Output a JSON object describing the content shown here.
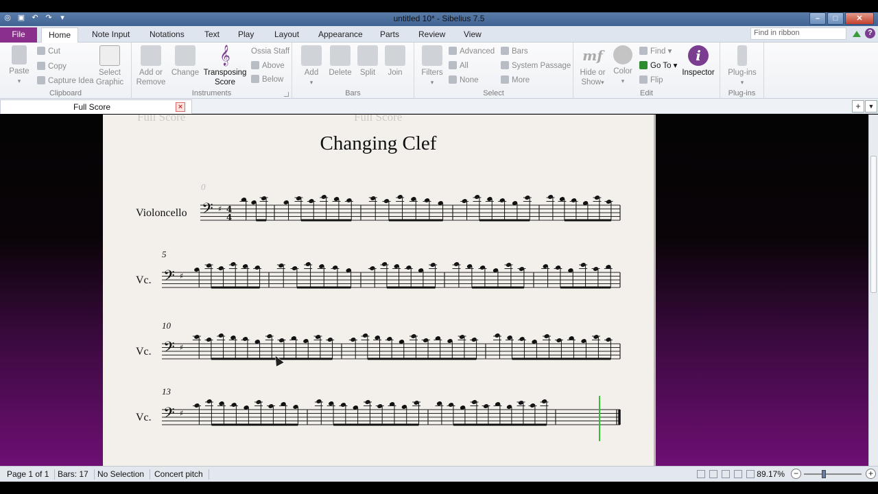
{
  "window": {
    "title": "untitled 10* - Sibelius 7.5"
  },
  "tabs": [
    "Home",
    "Note Input",
    "Notations",
    "Text",
    "Play",
    "Layout",
    "Appearance",
    "Parts",
    "Review",
    "View"
  ],
  "file_tab": "File",
  "search": {
    "placeholder": "Find in ribbon"
  },
  "ribbon": {
    "clipboard": {
      "label": "Clipboard",
      "paste": "Paste",
      "cut": "Cut",
      "copy": "Copy",
      "capture": "Capture Idea",
      "select_graphic_1": "Select",
      "select_graphic_2": "Graphic"
    },
    "instruments": {
      "label": "Instruments",
      "add_1": "Add or",
      "add_2": "Remove",
      "change": "Change",
      "transposing_1": "Transposing",
      "transposing_2": "Score",
      "ossia": "Ossia Staff",
      "above": "Above",
      "below": "Below"
    },
    "bars": {
      "label": "Bars",
      "add": "Add",
      "delete": "Delete",
      "split": "Split",
      "join": "Join"
    },
    "select": {
      "label": "Select",
      "filters": "Filters",
      "advanced": "Advanced",
      "all": "All",
      "none": "None",
      "bars": "Bars",
      "system_passage": "System Passage",
      "more": "More"
    },
    "edit": {
      "label": "Edit",
      "hide_1": "Hide or",
      "hide_2": "Show",
      "color": "Color",
      "find": "Find",
      "goto": "Go To",
      "flip": "Flip",
      "inspector": "Inspector"
    },
    "plugins": {
      "label": "Plug-ins",
      "plugins": "Plug-ins"
    }
  },
  "document_tab": "Full Score",
  "score": {
    "title": "Changing Clef",
    "ghost_left": "Full Score",
    "ghost_center": "Full Score",
    "systems": [
      {
        "label": "Violoncello",
        "bar_number": "0",
        "time_sig_top": "4",
        "time_sig_bottom": "4"
      },
      {
        "label": "Vc.",
        "bar_number": "5"
      },
      {
        "label": "Vc.",
        "bar_number": "10"
      },
      {
        "label": "Vc.",
        "bar_number": "13"
      }
    ]
  },
  "status": {
    "page": "Page 1 of 1",
    "bars": "Bars: 17",
    "selection": "No Selection",
    "pitch": "Concert pitch",
    "zoom": "89.17%"
  },
  "colors": {
    "file_tab": "#8a2f8c",
    "inspector": "#7a3d8f",
    "playback_line": "#2fc42f",
    "workspace_bottom": "#6e0f74"
  }
}
